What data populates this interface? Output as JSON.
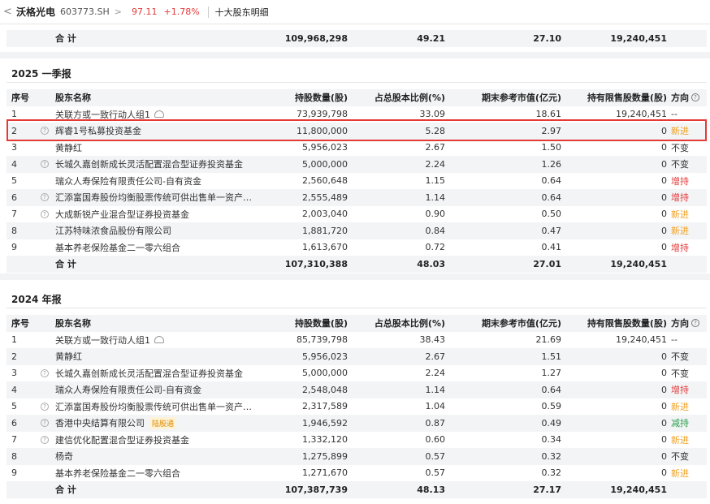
{
  "header": {
    "back": "<",
    "stock_name": "沃格光电",
    "stock_code": "603773.SH",
    "chevron": ">",
    "price": "97.11",
    "change_pct": "+1.78%",
    "page_title": "十大股东明细"
  },
  "top_total": {
    "label": "合 计",
    "holding": "109,968,298",
    "ratio": "49.21",
    "market_value": "27.10",
    "restricted": "19,240,451"
  },
  "columns": {
    "idx": "序号",
    "name": "股东名称",
    "holding": "持股数量(股)",
    "ratio": "占总股本比例(%)",
    "market_value": "期末参考市值(亿元)",
    "restricted": "持有限售股数量(股)",
    "direction": "方向"
  },
  "sections": [
    {
      "title": "2025 一季报",
      "rows": [
        {
          "idx": "1",
          "name": "关联方或一致行动人组1",
          "holding": "73,939,798",
          "ratio": "33.09",
          "mv": "18.61",
          "restricted": "19,240,451",
          "direction": "--"
        },
        {
          "idx": "2",
          "name": "辉睿1号私募投资基金",
          "holding": "11,800,000",
          "ratio": "5.28",
          "mv": "2.97",
          "restricted": "0",
          "direction": "新进"
        },
        {
          "idx": "3",
          "name": "黄静红",
          "holding": "5,956,023",
          "ratio": "2.67",
          "mv": "1.50",
          "restricted": "0",
          "direction": "不变"
        },
        {
          "idx": "4",
          "name": "长城久嘉创新成长灵活配置混合型证券投资基金",
          "holding": "5,000,000",
          "ratio": "2.24",
          "mv": "1.26",
          "restricted": "0",
          "direction": "不变"
        },
        {
          "idx": "5",
          "name": "瑞众人寿保险有限责任公司-自有资金",
          "holding": "2,560,648",
          "ratio": "1.15",
          "mv": "0.64",
          "restricted": "0",
          "direction": "增持"
        },
        {
          "idx": "6",
          "name": "汇添富国寿股份均衡股票传统可供出售单一资产…",
          "holding": "2,555,489",
          "ratio": "1.14",
          "mv": "0.64",
          "restricted": "0",
          "direction": "增持"
        },
        {
          "idx": "7",
          "name": "大成新锐产业混合型证券投资基金",
          "holding": "2,003,040",
          "ratio": "0.90",
          "mv": "0.50",
          "restricted": "0",
          "direction": "新进"
        },
        {
          "idx": "8",
          "name": "江苏特味浓食品股份有限公司",
          "holding": "1,881,720",
          "ratio": "0.84",
          "mv": "0.47",
          "restricted": "0",
          "direction": "新进"
        },
        {
          "idx": "9",
          "name": "基本养老保险基金二一零六组合",
          "holding": "1,613,670",
          "ratio": "0.72",
          "mv": "0.41",
          "restricted": "0",
          "direction": "增持"
        }
      ],
      "total": {
        "label": "合 计",
        "holding": "107,310,388",
        "ratio": "48.03",
        "mv": "27.01",
        "restricted": "19,240,451"
      }
    },
    {
      "title": "2024 年报",
      "rows": [
        {
          "idx": "1",
          "name": "关联方或一致行动人组1",
          "holding": "85,739,798",
          "ratio": "38.43",
          "mv": "21.69",
          "restricted": "19,240,451",
          "direction": "--"
        },
        {
          "idx": "2",
          "name": "黄静红",
          "holding": "5,956,023",
          "ratio": "2.67",
          "mv": "1.51",
          "restricted": "0",
          "direction": "不变"
        },
        {
          "idx": "3",
          "name": "长城久嘉创新成长灵活配置混合型证券投资基金",
          "holding": "5,000,000",
          "ratio": "2.24",
          "mv": "1.27",
          "restricted": "0",
          "direction": "不变"
        },
        {
          "idx": "4",
          "name": "瑞众人寿保险有限责任公司-自有资金",
          "holding": "2,548,048",
          "ratio": "1.14",
          "mv": "0.64",
          "restricted": "0",
          "direction": "增持"
        },
        {
          "idx": "5",
          "name": "汇添富国寿股份均衡股票传统可供出售单一资产…",
          "holding": "2,317,589",
          "ratio": "1.04",
          "mv": "0.59",
          "restricted": "0",
          "direction": "新进"
        },
        {
          "idx": "6",
          "name": "香港中央结算有限公司",
          "tag": "陆股通",
          "holding": "1,946,592",
          "ratio": "0.87",
          "mv": "0.49",
          "restricted": "0",
          "direction": "减持"
        },
        {
          "idx": "7",
          "name": "建信优化配置混合型证券投资基金",
          "holding": "1,332,120",
          "ratio": "0.60",
          "mv": "0.34",
          "restricted": "0",
          "direction": "新进"
        },
        {
          "idx": "8",
          "name": "杨奇",
          "holding": "1,275,899",
          "ratio": "0.57",
          "mv": "0.32",
          "restricted": "0",
          "direction": "不变"
        },
        {
          "idx": "9",
          "name": "基本养老保险基金二一零六组合",
          "holding": "1,271,670",
          "ratio": "0.57",
          "mv": "0.32",
          "restricted": "0",
          "direction": "新进"
        }
      ],
      "total": {
        "label": "合 计",
        "holding": "107,387,739",
        "ratio": "48.13",
        "mv": "27.17",
        "restricted": "19,240,451"
      }
    }
  ],
  "colors": {
    "up": "#e23a3a",
    "new": "#f0a020",
    "down": "#2a9d4a",
    "highlight_box": "#e53935"
  }
}
